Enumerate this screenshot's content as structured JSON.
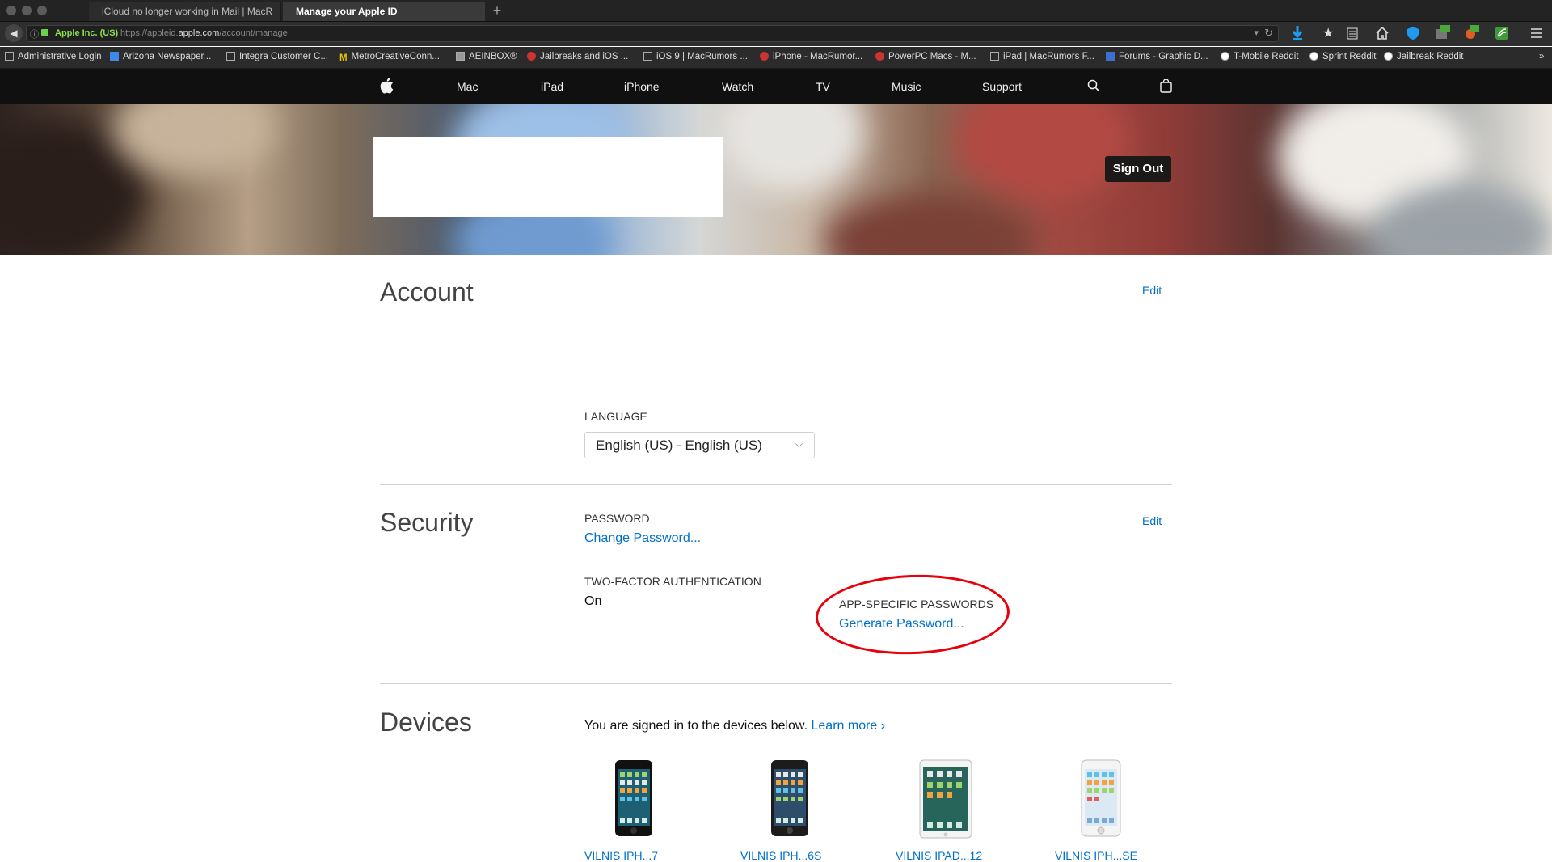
{
  "browser": {
    "tabs": [
      {
        "label": "iCloud no longer working in Mail | MacR"
      },
      {
        "label": "Manage your Apple ID"
      }
    ],
    "new_tab": "+",
    "back": "◀",
    "url_org": "Apple Inc. (US)",
    "url_prefix": "https://appleid.",
    "url_domain": "apple.com",
    "url_path": "/account/manage",
    "bookmarks": [
      {
        "label": "Administrative Login"
      },
      {
        "label": "Arizona Newspaper..."
      },
      {
        "label": "Integra Customer C..."
      },
      {
        "label": "MetroCreativeConn..."
      },
      {
        "label": "AEINBOX®"
      },
      {
        "label": "Jailbreaks and iOS ..."
      },
      {
        "label": "iOS 9 | MacRumors ..."
      },
      {
        "label": "iPhone - MacRumor..."
      },
      {
        "label": "PowerPC Macs - M..."
      },
      {
        "label": "iPad | MacRumors F..."
      },
      {
        "label": "Forums - Graphic D..."
      },
      {
        "label": "T-Mobile Reddit"
      },
      {
        "label": "Sprint Reddit"
      },
      {
        "label": "Jailbreak Reddit"
      }
    ],
    "overflow": "»",
    "ext_badges": {
      "first": "on",
      "second": "on"
    }
  },
  "globalnav": {
    "items": [
      {
        "label": "Mac"
      },
      {
        "label": "iPad"
      },
      {
        "label": "iPhone"
      },
      {
        "label": "Watch"
      },
      {
        "label": "TV"
      },
      {
        "label": "Music"
      },
      {
        "label": "Support"
      }
    ]
  },
  "hero": {
    "sign_out": "Sign Out"
  },
  "account": {
    "title": "Account",
    "edit": "Edit",
    "language_label": "LANGUAGE",
    "language_value": "English (US) - English (US)"
  },
  "security": {
    "title": "Security",
    "edit": "Edit",
    "password_label": "PASSWORD",
    "password_link": "Change Password...",
    "two_factor_label": "TWO-FACTOR AUTHENTICATION",
    "two_factor_value": "On",
    "app_passwords_label": "APP-SPECIFIC PASSWORDS",
    "app_passwords_link": "Generate Password..."
  },
  "devices": {
    "title": "Devices",
    "intro": "You are signed in to the devices below.",
    "learn_more": "Learn more",
    "learn_more_chevron": "›",
    "items": [
      {
        "name": "iphone-7-black",
        "label": "VILNIS IPH...7"
      },
      {
        "name": "iphone-6s-space-gray",
        "label": "VILNIS IPH...6S"
      },
      {
        "name": "ipad-white",
        "label": "VILNIS IPAD...12"
      },
      {
        "name": "iphone-se-white",
        "label": "VILNIS IPH...SE"
      }
    ]
  },
  "colors": {
    "link": "#0070c9",
    "annotation": "#e8000b"
  }
}
